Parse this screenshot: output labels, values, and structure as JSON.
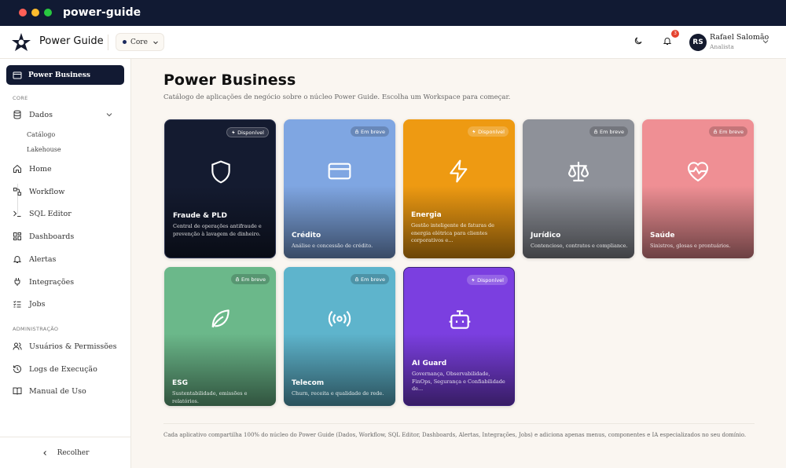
{
  "window": {
    "title": "power-guide"
  },
  "topbar": {
    "brand": "Power Guide",
    "workspace": "Core",
    "notifications": "3",
    "user": {
      "initials": "RS",
      "name": "Rafael Salomão",
      "role": "Analista"
    }
  },
  "sidebar": {
    "active": "Power Business",
    "section_core": "CORE",
    "dados": "Dados",
    "dados_children": [
      "Catálogo",
      "Lakehouse"
    ],
    "items": [
      "Home",
      "Workflow",
      "SQL Editor",
      "Dashboards",
      "Alertas",
      "Integrações",
      "Jobs"
    ],
    "section_admin": "ADMINISTRAÇÃO",
    "admin_items": [
      "Usuários & Permissões",
      "Logs de Execução",
      "Manual de Uso"
    ],
    "collapse": "Recolher"
  },
  "main": {
    "title": "Power Business",
    "subtitle": "Catálogo de aplicações de negócio sobre o núcleo Power Guide. Escolha um Workspace para começar.",
    "cards": [
      {
        "name": "Fraude & PLD",
        "desc": "Central de operações antifraude e prevenção à lavagem de dinheiro.",
        "status": "Disponível",
        "icon": "shield-icon",
        "color": "#141b30"
      },
      {
        "name": "Crédito",
        "desc": "Análise e concessão de crédito.",
        "status": "Em breve",
        "icon": "credit-card-icon",
        "color": "#7fa6e2"
      },
      {
        "name": "Energia",
        "desc": "Gestão inteligente de faturas de energia elétrica para clientes corporativos e...",
        "status": "Disponível",
        "icon": "zap-icon",
        "color": "#ee9a12"
      },
      {
        "name": "Jurídico",
        "desc": "Contencioso, contratos e compliance.",
        "status": "Em breve",
        "icon": "scale-icon",
        "color": "#8e9199"
      },
      {
        "name": "Saúde",
        "desc": "Sinistros, glosas e prontuários.",
        "status": "Em breve",
        "icon": "heart-pulse-icon",
        "color": "#ef8f94"
      },
      {
        "name": "ESG",
        "desc": "Sustentabilidade, emissões e relatórios.",
        "status": "Em breve",
        "icon": "leaf-icon",
        "color": "#6bb88a"
      },
      {
        "name": "Telecom",
        "desc": "Churn, receita e qualidade de rede.",
        "status": "Em breve",
        "icon": "radio-icon",
        "color": "#5eb4cc"
      },
      {
        "name": "AI Guard",
        "desc": "Governança, Observabilidade, FinOps, Segurança e Confiabilidade de...",
        "status": "Disponível",
        "icon": "bot-icon",
        "color": "#7b3fe0"
      }
    ],
    "footnote": "Cada aplicativo compartilha 100% do núcleo do Power Guide (Dados, Workflow, SQL Editor, Dashboards, Alertas, Integrações, Jobs) e adiciona apenas menus, componentes e IA especializados no seu domínio."
  }
}
